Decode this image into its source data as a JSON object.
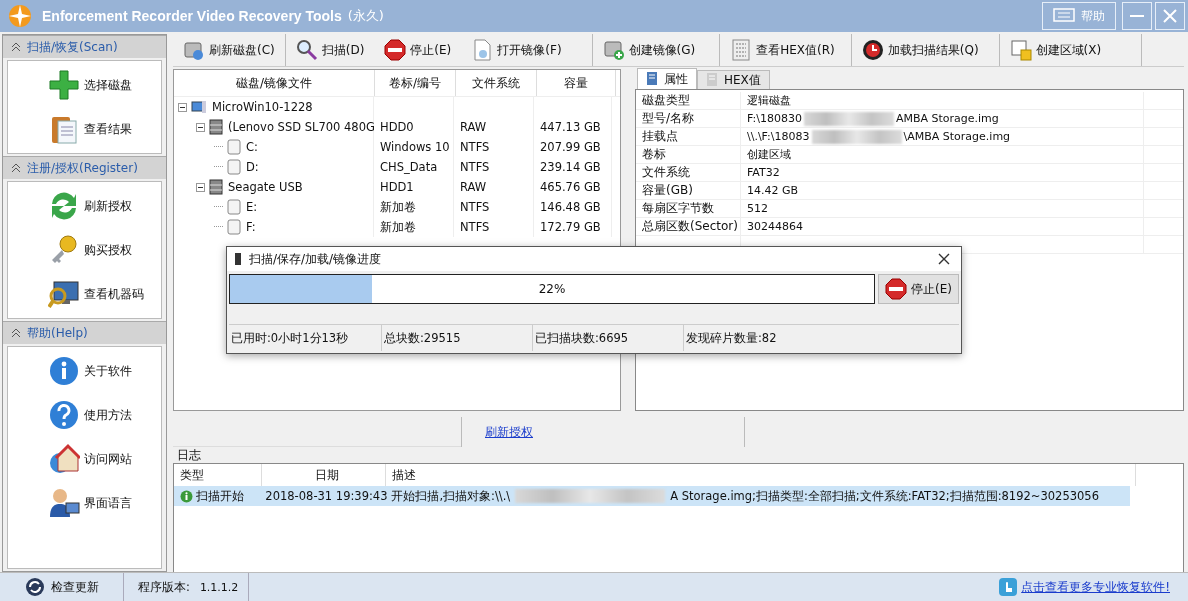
{
  "window": {
    "title": "Enforcement Recorder Video Recovery Tools",
    "title_suffix": "(永久)",
    "help": "帮助"
  },
  "sidebar": [
    {
      "title": "扫描/恢复(Scan)",
      "items": [
        {
          "label": "选择磁盘",
          "kind": "plus"
        },
        {
          "label": "查看结果",
          "kind": "clipboard"
        }
      ]
    },
    {
      "title": "注册/授权(Register)",
      "items": [
        {
          "label": "刷新授权",
          "kind": "refresh"
        },
        {
          "label": "购买授权",
          "kind": "key"
        },
        {
          "label": "查看机器码",
          "kind": "monitor"
        }
      ]
    },
    {
      "title": "帮助(Help)",
      "items": [
        {
          "label": "关于软件",
          "kind": "info"
        },
        {
          "label": "使用方法",
          "kind": "question"
        },
        {
          "label": "访问网站",
          "kind": "home"
        },
        {
          "label": "界面语言",
          "kind": "user"
        }
      ]
    }
  ],
  "toolbar": [
    {
      "label": "刷新磁盘(C)",
      "kind": "disk"
    },
    {
      "label": "扫描(D)",
      "kind": "search"
    },
    {
      "label": "停止(E)",
      "kind": "stop"
    },
    {
      "label": "打开镜像(F)",
      "kind": "file"
    },
    {
      "label": "创建镜像(G)",
      "kind": "diskadd"
    },
    {
      "label": "查看HEX值(R)",
      "kind": "hex"
    },
    {
      "label": "加载扫描结果(Q)",
      "kind": "load"
    },
    {
      "label": "创建区域(X)",
      "kind": "region"
    }
  ],
  "tree": {
    "columns": [
      "磁盘/镜像文件",
      "卷标/编号",
      "文件系统",
      "容量"
    ],
    "nodes": [
      {
        "name": "MicroWin10-1228",
        "kind": "computer",
        "expanded": true,
        "children": [
          {
            "name": "(Lenovo SSD SL700 480G",
            "kind": "disk",
            "label": "HDD0",
            "fs": "RAW",
            "size": "447.13 GB",
            "expanded": true,
            "children": [
              {
                "name": "C:",
                "kind": "volume",
                "label": "Windows 10",
                "fs": "NTFS",
                "size": "207.99 GB"
              },
              {
                "name": "D:",
                "kind": "volume",
                "label": "CHS_Data",
                "fs": "NTFS",
                "size": "239.14 GB"
              }
            ]
          },
          {
            "name": "Seagate USB",
            "kind": "disk",
            "label": "HDD1",
            "fs": "RAW",
            "size": "465.76 GB",
            "expanded": true,
            "children": [
              {
                "name": "E:",
                "kind": "volume",
                "label": "新加卷",
                "fs": "NTFS",
                "size": "146.48 GB"
              },
              {
                "name": "F:",
                "kind": "volume",
                "label": "新加卷",
                "fs": "NTFS",
                "size": "172.79 GB"
              }
            ]
          }
        ]
      }
    ]
  },
  "tabs": [
    {
      "label": "属性",
      "selected": true
    },
    {
      "label": "HEX值",
      "selected": false
    }
  ],
  "properties": [
    {
      "name": "磁盘类型",
      "value": "逻辑磁盘"
    },
    {
      "name": "型号/名称",
      "value": "F:\\180830",
      "value_tail": "AMBA Storage.img"
    },
    {
      "name": "挂载点",
      "value": "\\\\.\\F:\\18083",
      "value_tail": "\\AMBA Storage.img"
    },
    {
      "name": "卷标",
      "value": "创建区域"
    },
    {
      "name": "文件系统",
      "value": "FAT32"
    },
    {
      "name": "容量(GB)",
      "value": "14.42 GB"
    },
    {
      "name": "每扇区字节数",
      "value": "512"
    },
    {
      "name": "总扇区数(Sector)",
      "value": "30244864"
    }
  ],
  "bottom_tabs": [
    {
      "label": "刷新授权"
    }
  ],
  "dialog": {
    "title": "扫描/保存/加载/镜像进度",
    "level": 0.22,
    "percent": "22%",
    "stop": "停止(E)",
    "stats": [
      "已用时:0小时1分13秒",
      "总块数:29515",
      "已扫描块数:6695",
      "发现碎片数量:82"
    ]
  },
  "log": {
    "title": "日志",
    "columns": [
      "类型",
      "日期",
      "描述"
    ],
    "rows": [
      {
        "type": "扫描开始",
        "date": "2018-08-31 19:39:43",
        "desc": "开始扫描,扫描对象:\\\\.\\",
        "desc_tail": "A Storage.img;扫描类型:全部扫描;文件系统:FAT32;扫描范围:8192~30253056",
        "selected": true
      }
    ]
  },
  "status_bar": {
    "update": "检查更新",
    "version_label": "程序版本:",
    "version": "1.1.1.2",
    "link": "点击查看更多专业恢复软件!"
  }
}
